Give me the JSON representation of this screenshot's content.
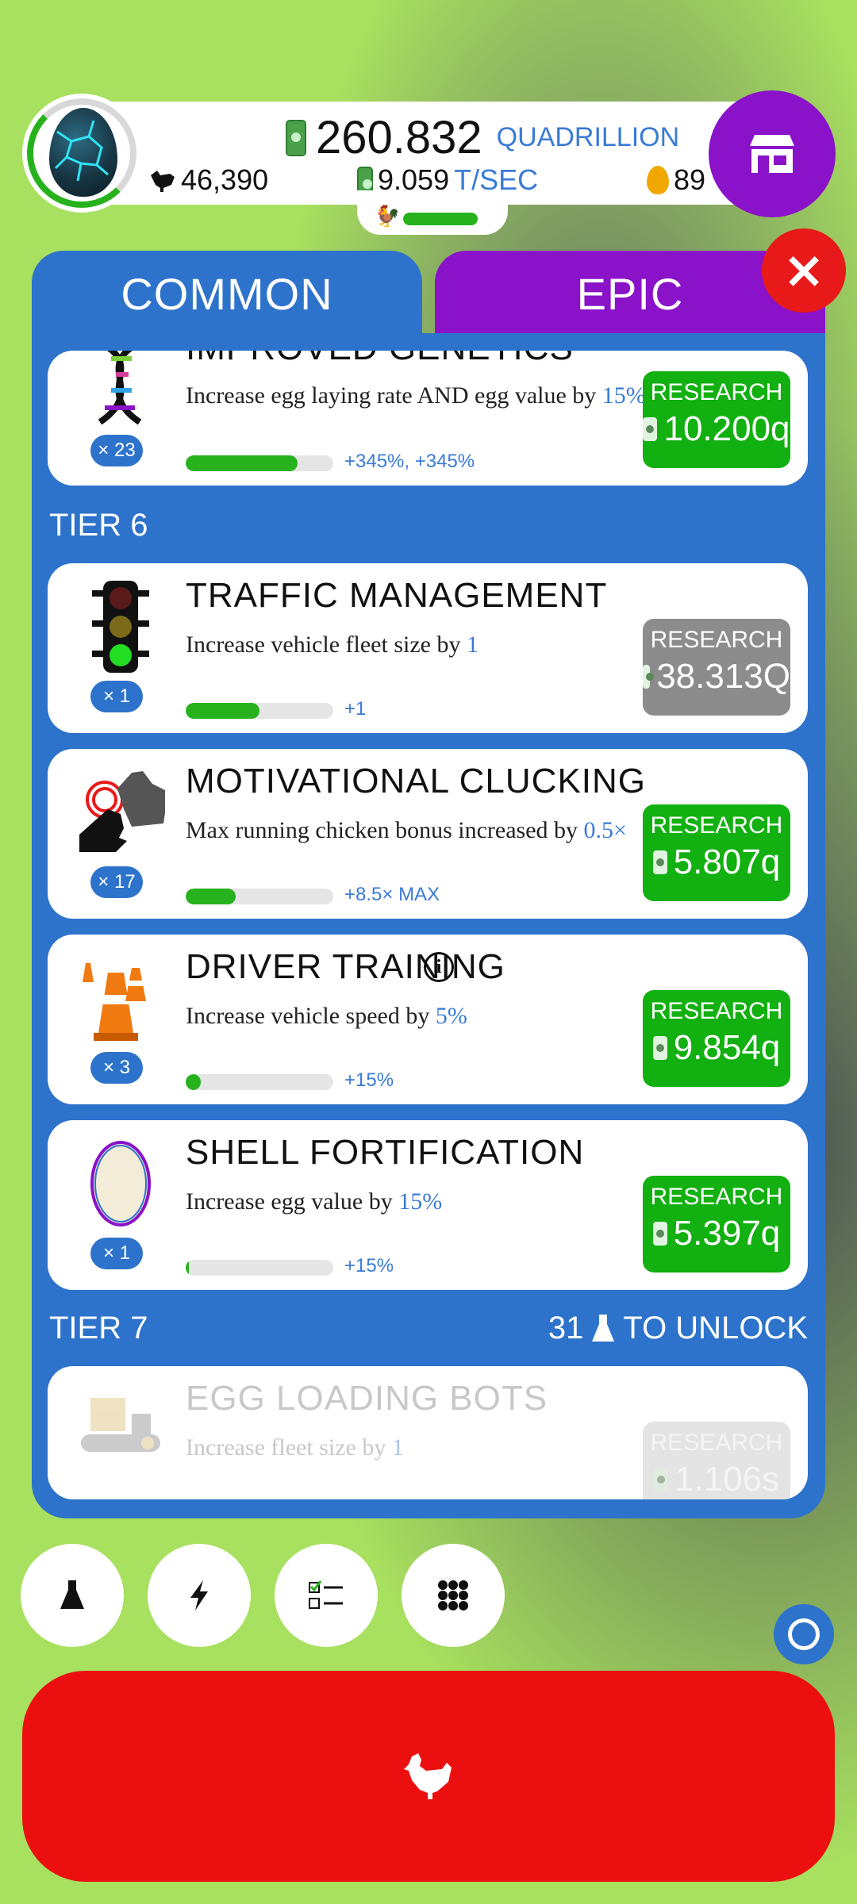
{
  "hud": {
    "money_amount": "260.832",
    "money_unit": "QUADRILLION",
    "chickens": "46,390",
    "rate_amount": "9.059",
    "rate_unit": "T/SEC",
    "golden_eggs": "89"
  },
  "tabs": {
    "common": "COMMON",
    "epic": "EPIC"
  },
  "close_label": "×",
  "cards_top": [
    {
      "title": "IMPROVED GENETICS",
      "desc_prefix": "Increase egg laying rate AND egg value by ",
      "desc_value": "15%",
      "badge": "× 23",
      "progress_label": "+345%, +345%",
      "progress": 0.76,
      "research_label": "RESEARCH",
      "price": "10.200q",
      "state": "available"
    }
  ],
  "tier6": {
    "label": "TIER 6",
    "cards": [
      {
        "title": "TRAFFIC MANAGEMENT",
        "desc_prefix": "Increase vehicle fleet size by ",
        "desc_value": "1",
        "badge": "× 1",
        "progress_label": "+1",
        "progress": 0.5,
        "research_label": "RESEARCH",
        "price": "38.313Q",
        "state": "unaffordable"
      },
      {
        "title": "MOTIVATIONAL CLUCKING",
        "desc_prefix": "Max running chicken bonus increased by ",
        "desc_value": "0.5×",
        "badge": "× 17",
        "progress_label": "+8.5× MAX",
        "progress": 0.34,
        "research_label": "RESEARCH",
        "price": "5.807q",
        "state": "available"
      },
      {
        "title": "DRIVER TRAINING",
        "desc_prefix": "Increase vehicle speed by ",
        "desc_value": "5%",
        "badge": "× 3",
        "progress_label": "+15%",
        "progress": 0.1,
        "research_label": "RESEARCH",
        "price": "9.854q",
        "state": "available",
        "info_icon": "info-icon"
      },
      {
        "title": "SHELL FORTIFICATION",
        "desc_prefix": "Increase egg value by ",
        "desc_value": "15%",
        "badge": "× 1",
        "progress_label": "+15%",
        "progress": 0.02,
        "research_label": "RESEARCH",
        "price": "5.397q",
        "state": "available"
      }
    ]
  },
  "tier7": {
    "label": "TIER 7",
    "unlock_count": "31",
    "unlock_text": "TO UNLOCK",
    "cards": [
      {
        "title": "EGG LOADING BOTS",
        "desc_prefix": "Increase fleet size by ",
        "desc_value": "1",
        "research_label": "RESEARCH",
        "price": "1.106s",
        "state": "locked"
      }
    ]
  },
  "bottom_buttons": [
    "flask-icon",
    "lightning-icon",
    "checklist-icon",
    "grid-icon"
  ],
  "colors": {
    "background": "#a8e05f",
    "panel": "#2d73cb",
    "epic": "#8a12c9",
    "research_green": "#12b010",
    "research_gray": "#8c8c8c",
    "hatch_red": "#ec0f0f",
    "close_red": "#e81919",
    "highlight_blue": "#3a7bd5"
  }
}
